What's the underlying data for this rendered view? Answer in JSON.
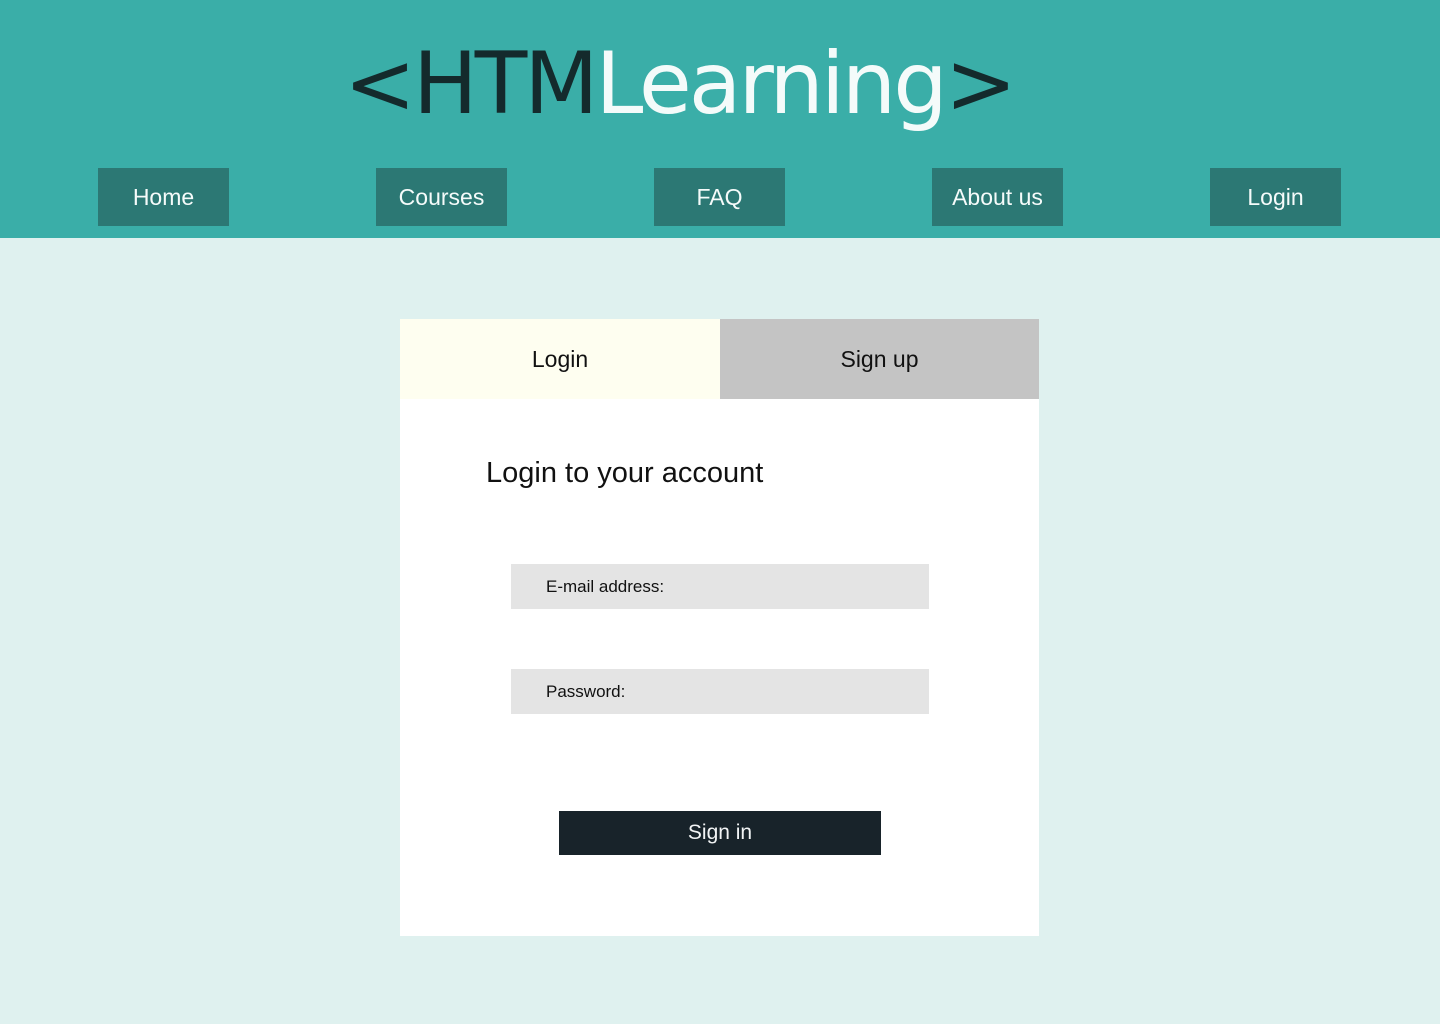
{
  "brand": {
    "logo_dark_left": "<HTM",
    "logo_light": "Learning",
    "logo_dark_right": ">",
    "colors": {
      "header_bg": "#3aaea8",
      "nav_button_bg": "#2c7874",
      "page_bg": "#dff1ef",
      "signin_bg": "#18232a"
    }
  },
  "nav": {
    "items": [
      {
        "label": "Home"
      },
      {
        "label": "Courses"
      },
      {
        "label": "FAQ"
      },
      {
        "label": "About us"
      },
      {
        "label": "Login"
      }
    ]
  },
  "auth": {
    "tabs": {
      "login": "Login",
      "signup": "Sign up",
      "active": "login"
    },
    "title": "Login to your account",
    "email_placeholder": "E-mail address:",
    "password_placeholder": "Password:",
    "submit_label": "Sign in"
  }
}
